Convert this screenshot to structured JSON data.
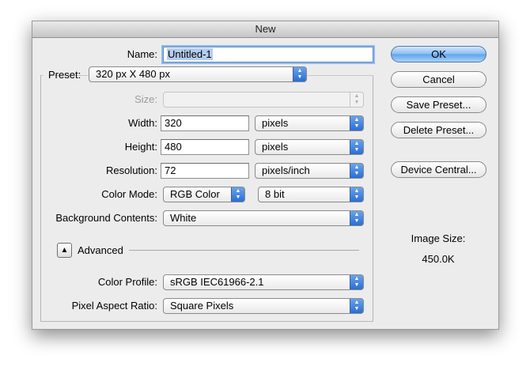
{
  "window": {
    "title": "New"
  },
  "name": {
    "label": "Name:",
    "value": "Untitled-1"
  },
  "preset": {
    "label": "Preset:",
    "value": "320 px X 480 px"
  },
  "size": {
    "label": "Size:",
    "value": ""
  },
  "width": {
    "label": "Width:",
    "value": "320",
    "unit": "pixels"
  },
  "height": {
    "label": "Height:",
    "value": "480",
    "unit": "pixels"
  },
  "resolution": {
    "label": "Resolution:",
    "value": "72",
    "unit": "pixels/inch"
  },
  "color_mode": {
    "label": "Color Mode:",
    "value": "RGB Color",
    "depth": "8 bit"
  },
  "background": {
    "label": "Background Contents:",
    "value": "White"
  },
  "advanced": {
    "label": "Advanced"
  },
  "color_profile": {
    "label": "Color Profile:",
    "value": "sRGB IEC61966-2.1"
  },
  "pixel_aspect": {
    "label": "Pixel Aspect Ratio:",
    "value": "Square Pixels"
  },
  "buttons": {
    "ok": "OK",
    "cancel": "Cancel",
    "save_preset": "Save Preset...",
    "delete_preset": "Delete Preset...",
    "device_central": "Device Central..."
  },
  "image_size": {
    "label": "Image Size:",
    "value": "450.0K"
  }
}
